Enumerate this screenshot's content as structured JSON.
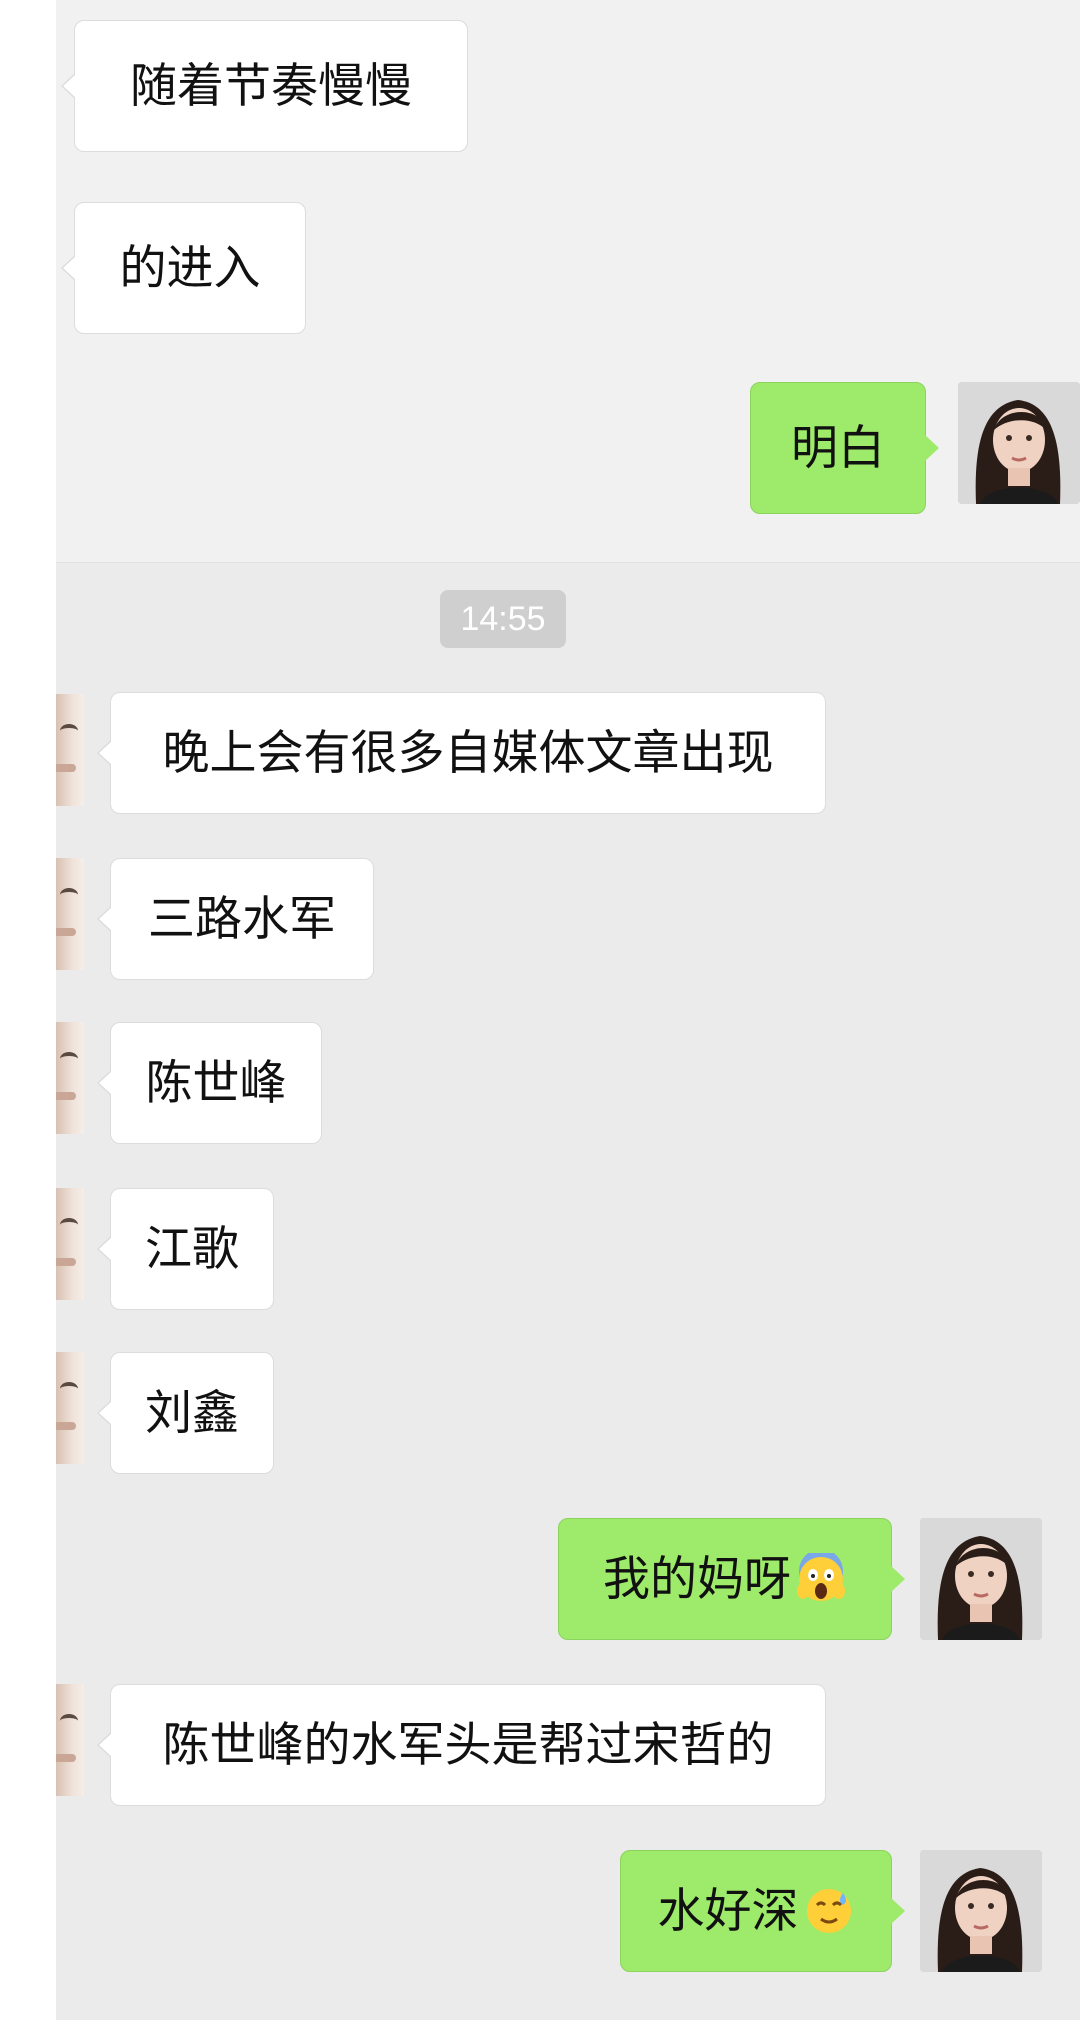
{
  "timestamp": "14:55",
  "messages": [
    {
      "text": "随着节奏慢慢"
    },
    {
      "text": "的进入"
    },
    {
      "text": "明白"
    },
    {
      "text": "晚上会有很多自媒体文章出现"
    },
    {
      "text": "三路水军"
    },
    {
      "text": "陈世峰"
    },
    {
      "text": "江歌"
    },
    {
      "text": "刘鑫"
    },
    {
      "text": "我的妈呀"
    },
    {
      "text": "陈世峰的水军头是帮过宋哲的"
    },
    {
      "text": "水好深"
    }
  ],
  "icons": {
    "scream": "face-screaming-in-fear-emoji",
    "sweat": "face-with-sweat-emoji"
  },
  "colors": {
    "sent_bubble": "#9eea6a",
    "received_bubble": "#ffffff",
    "background": "#ededed"
  }
}
